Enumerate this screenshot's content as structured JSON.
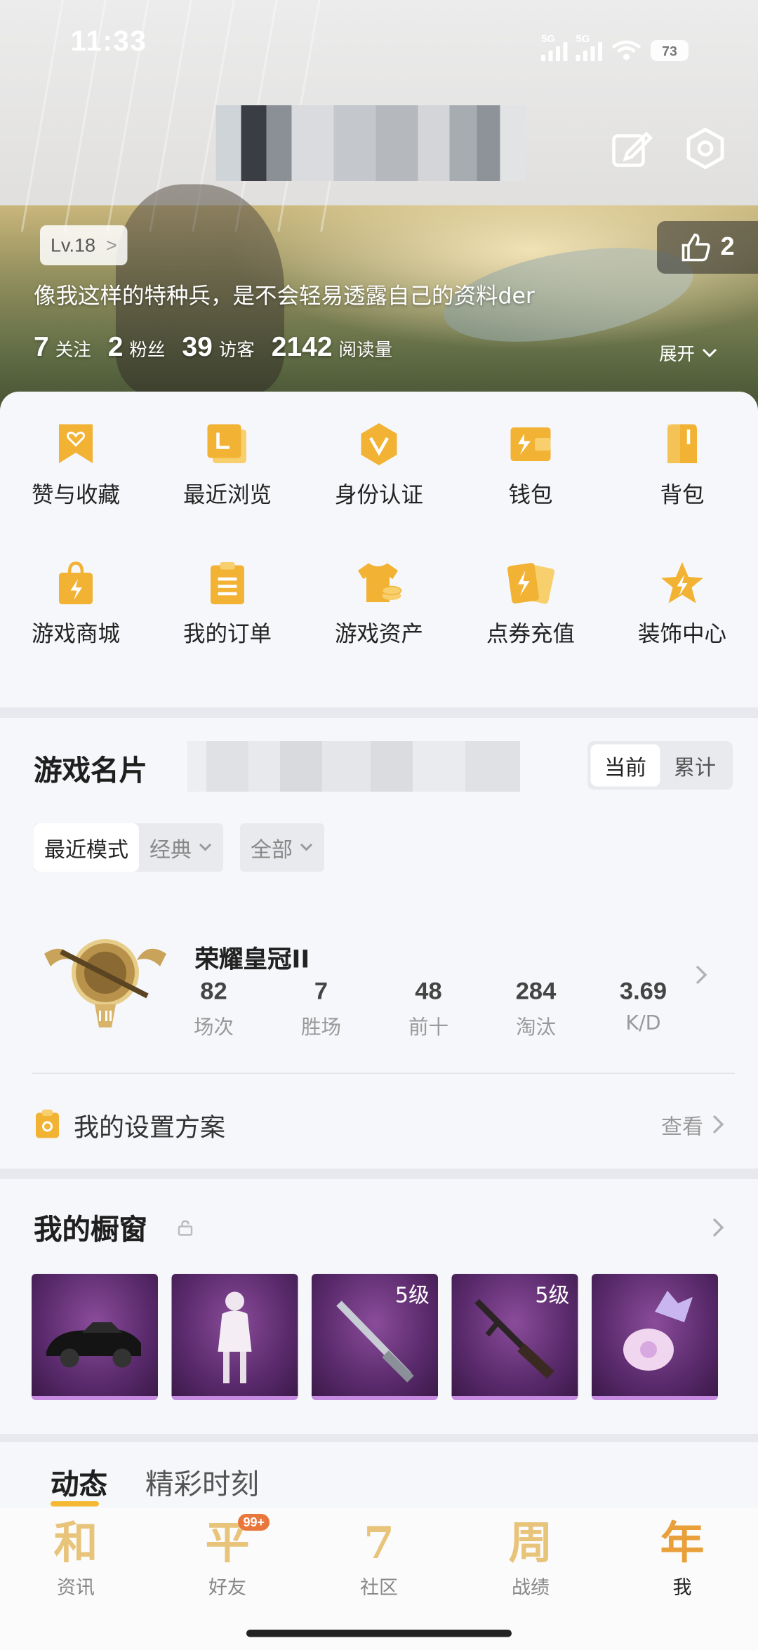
{
  "status": {
    "time": "11:33",
    "sig1": "5G",
    "sig2": "5G",
    "battery": "73"
  },
  "profile": {
    "level": "Lv.18",
    "likes": "2",
    "motto": "像我这样的特种兵，是不会轻易透露自己的资料der",
    "stats": [
      {
        "num": "7",
        "label": "关注"
      },
      {
        "num": "2",
        "label": "粉丝"
      },
      {
        "num": "39",
        "label": "访客"
      },
      {
        "num": "2142",
        "label": "阅读量"
      }
    ],
    "expand": "展开"
  },
  "shortcuts": [
    {
      "label": "赞与收藏",
      "icon": "bookmark-heart-icon"
    },
    {
      "label": "最近浏览",
      "icon": "recent-pages-icon"
    },
    {
      "label": "身份认证",
      "icon": "verify-badge-icon"
    },
    {
      "label": "钱包",
      "icon": "wallet-icon"
    },
    {
      "label": "背包",
      "icon": "backpack-icon"
    },
    {
      "label": "游戏商城",
      "icon": "shopping-bag-icon"
    },
    {
      "label": "我的订单",
      "icon": "order-clipboard-icon"
    },
    {
      "label": "游戏资产",
      "icon": "shirt-coin-icon"
    },
    {
      "label": "点券充值",
      "icon": "coupon-cards-icon"
    },
    {
      "label": "装饰中心",
      "icon": "star-bolt-icon"
    }
  ],
  "game_card": {
    "title": "游戏名片",
    "seg": [
      "当前",
      "累计"
    ],
    "mode_recent": "最近模式",
    "mode_classic": "经典",
    "filter_all": "全部",
    "rank_name": "荣耀皇冠II",
    "stats": [
      {
        "value": "82",
        "label": "场次"
      },
      {
        "value": "7",
        "label": "胜场"
      },
      {
        "value": "48",
        "label": "前十"
      },
      {
        "value": "284",
        "label": "淘汰"
      },
      {
        "value": "3.69",
        "label": "K/D"
      }
    ],
    "settings_label": "我的设置方案",
    "view_label": "查看"
  },
  "showcase": {
    "title": "我的橱窗",
    "items": [
      {
        "name": "car",
        "level": ""
      },
      {
        "name": "outfit",
        "level": ""
      },
      {
        "name": "shotgun",
        "level": "5级"
      },
      {
        "name": "rifle",
        "level": "5级"
      },
      {
        "name": "flower-pendant",
        "level": ""
      }
    ]
  },
  "tabs": [
    "动态",
    "精彩时刻"
  ],
  "bottom_nav": [
    {
      "glyph": "和",
      "label": "资讯"
    },
    {
      "glyph": "平",
      "label": "好友",
      "badge": "99+"
    },
    {
      "glyph": "7",
      "label": "社区"
    },
    {
      "glyph": "周",
      "label": "战绩"
    },
    {
      "glyph": "年",
      "label": "我"
    }
  ],
  "colors": {
    "accent": "#f5b833",
    "icon_gold": "#f2b233",
    "tile_purple": "#5a2a6c"
  }
}
